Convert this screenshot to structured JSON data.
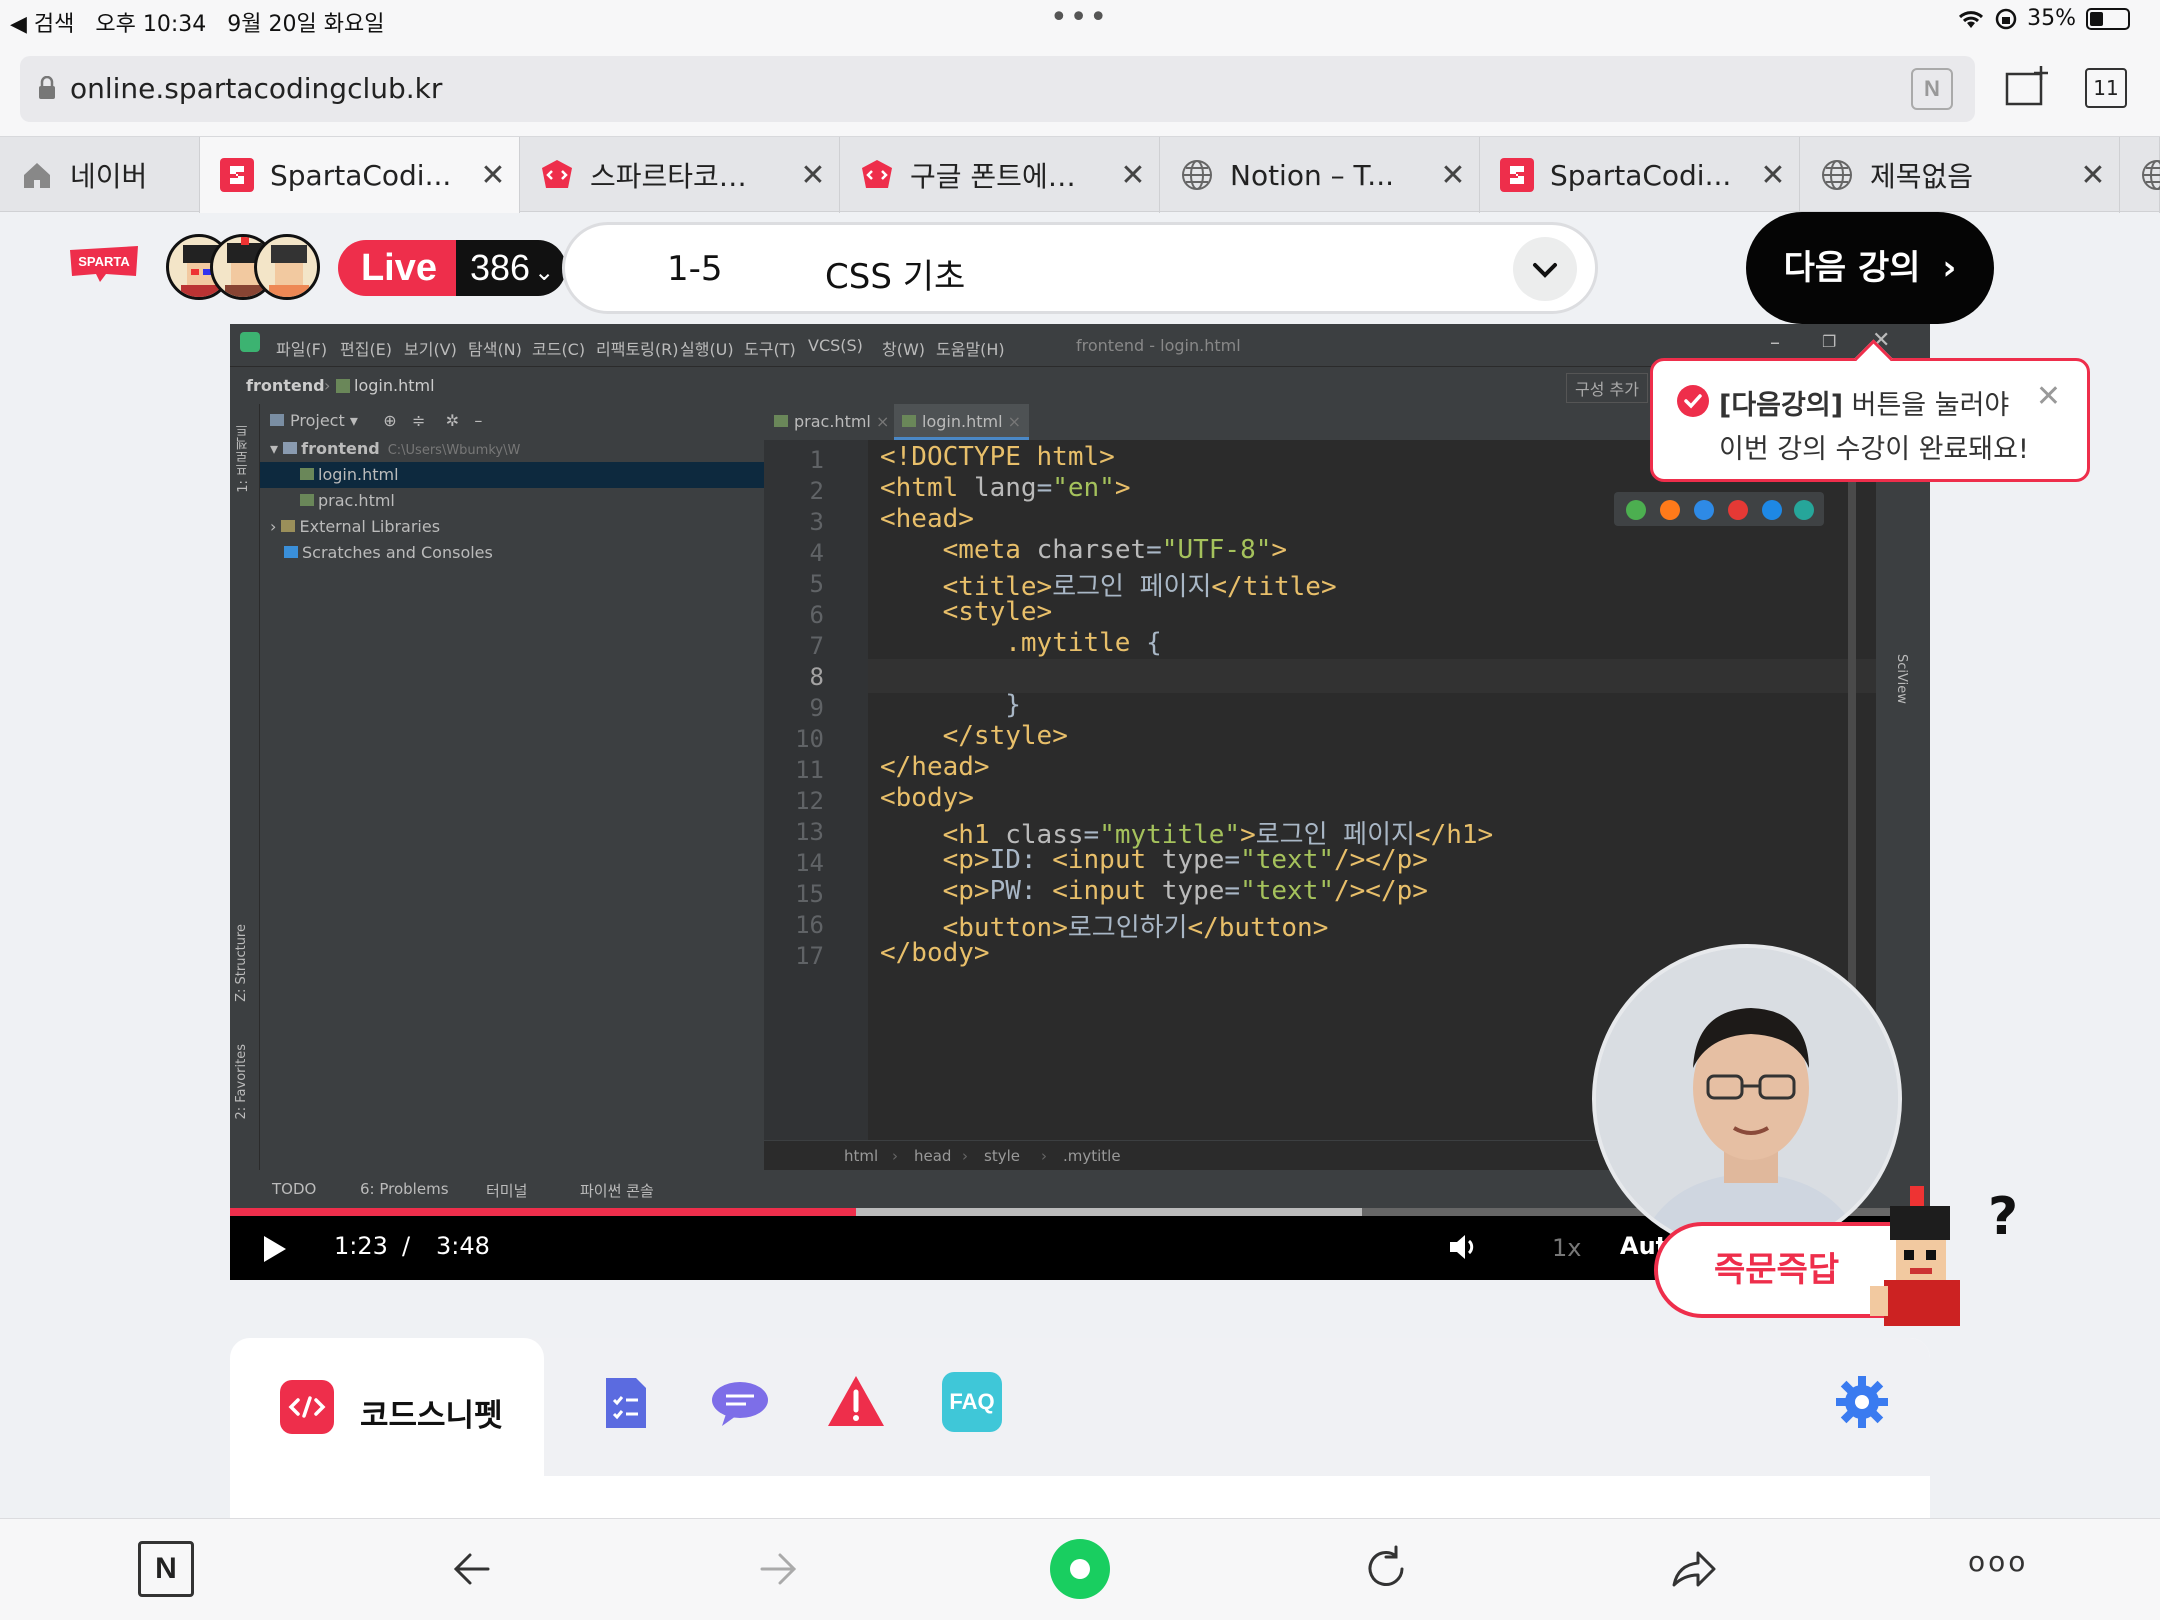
{
  "status_bar": {
    "back_app": "◀ 검색",
    "time": "오후 10:34",
    "date": "9월 20일 화요일",
    "battery": "35%",
    "battery_level": 0.35
  },
  "address_bar": {
    "url": "online.spartacodingclub.kr",
    "tab_count": "11"
  },
  "tabs": [
    {
      "label": "네이버",
      "icon": "home-icon",
      "active": false,
      "closable": false
    },
    {
      "label": "SpartaCodi...",
      "icon": "sparta-favicon",
      "active": true,
      "closable": true
    },
    {
      "label": "스파르타코…",
      "icon": "code-favicon",
      "active": false,
      "closable": true
    },
    {
      "label": "구글 폰트에…",
      "icon": "code-favicon",
      "active": false,
      "closable": true
    },
    {
      "label": "Notion – T...",
      "icon": "globe-icon",
      "active": false,
      "closable": true
    },
    {
      "label": "SpartaCodi...",
      "icon": "sparta-favicon",
      "active": false,
      "closable": true
    },
    {
      "label": "제목없음",
      "icon": "globe-icon",
      "active": false,
      "closable": true
    }
  ],
  "header": {
    "logo_text": "SPARTA",
    "live_label": "Live",
    "viewer_count": "386",
    "lecture_number": "1-5",
    "lecture_title": "CSS 기초",
    "next_button": "다음 강의"
  },
  "tooltip": {
    "bold": "[다음강의]",
    "line1_rest": " 버튼을 눌러야",
    "line2": "이번 강의 수강이 완료돼요!"
  },
  "ide": {
    "menu": [
      "파일(F)",
      "편집(E)",
      "보기(V)",
      "탐색(N)",
      "코드(C)",
      "리팩토링(R)",
      "실행(U)",
      "도구(T)",
      "VCS(S)",
      "창(W)",
      "도움말(H)"
    ],
    "window_title": "frontend - login.html",
    "nav_project": "frontend",
    "nav_file": "login.html",
    "config_button": "구성 추가",
    "project_header": "Project",
    "tree": [
      {
        "label": "frontend",
        "extra": "C:\\Users\\Wbumky\\W"
      },
      {
        "label": "login.html",
        "extra": ""
      },
      {
        "label": "prac.html",
        "extra": ""
      },
      {
        "label": "External Libraries",
        "extra": ""
      },
      {
        "label": "Scratches and Consoles",
        "extra": ""
      }
    ],
    "editor_tabs": [
      "prac.html",
      "login.html"
    ],
    "line_numbers": [
      "1",
      "2",
      "3",
      "4",
      "5",
      "6",
      "7",
      "8",
      "9",
      "10",
      "11",
      "12",
      "13",
      "14",
      "15",
      "16",
      "17"
    ],
    "breadcrumb": [
      "html",
      "head",
      "style",
      ".mytitle"
    ],
    "bottom_tabs": [
      "TODO",
      "6: Problems",
      "터미널",
      "파이썬 콘솔"
    ],
    "side_labels": [
      "1: 프로젝트",
      "Z: Structure",
      "2: Favorites",
      "SciView"
    ]
  },
  "player": {
    "current_time": "1:23",
    "separator": "/",
    "duration": "3:48",
    "speed": "1x",
    "quality": "Aut",
    "played_fraction": 0.368,
    "buffered_fraction": 0.666
  },
  "qa_button": "즉문즉답",
  "panel": {
    "active_tab": "코드스니펫",
    "tabs": [
      "snippet-icon",
      "checklist-icon",
      "chat-icon",
      "warning-icon",
      "faq-icon"
    ],
    "faq_label": "FAQ"
  },
  "colors": {
    "brand_red": "#ee2e4b",
    "ide_bg": "#2b2b2b",
    "tag_color": "#e8bf6a",
    "string_color": "#a5c25c"
  }
}
